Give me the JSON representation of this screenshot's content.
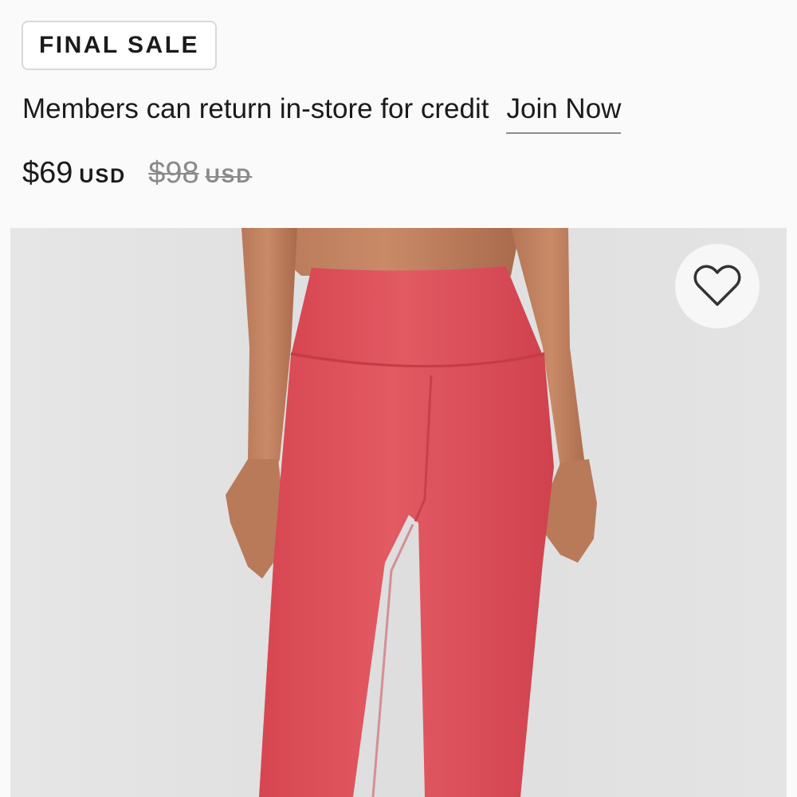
{
  "badge": {
    "label": "FINAL SALE"
  },
  "promo": {
    "message": "Members can return in-store for credit",
    "link_label": "Join Now"
  },
  "price": {
    "current_amount": "$69",
    "current_currency": "USD",
    "original_amount": "$98",
    "original_currency": "USD"
  },
  "product_image": {
    "alt": "Model wearing high-rise pink leggings",
    "product_color": "#e0525c"
  },
  "wishlist": {
    "icon": "heart-outline-icon",
    "aria_label": "Add to wishlist"
  },
  "colors": {
    "text": "#1a1a1a",
    "strikethrough": "#8a8a8a",
    "image_background": "#e3e3e3"
  }
}
